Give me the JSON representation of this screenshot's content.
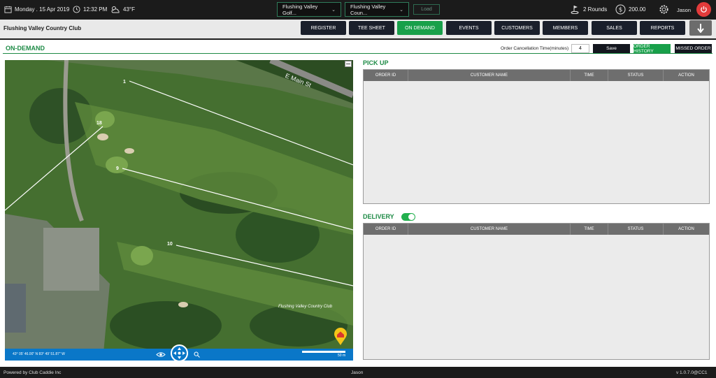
{
  "topbar": {
    "date": "Monday . 15 Apr 2019",
    "time": "12:32 PM",
    "weather": "43°F",
    "course_select": "Flushing Valley Golf...",
    "club_select": "Flushing Valley Coun...",
    "load_label": "Load",
    "rounds": "2 Rounds",
    "balance": "200.00",
    "user": "Jason"
  },
  "subbar": {
    "club_name": "Flushing Valley Country Club",
    "nav": [
      "REGISTER",
      "TEE SHEET",
      "ON DEMAND",
      "EVENTS",
      "CUSTOMERS",
      "MEMBERS",
      "SALES",
      "REPORTS"
    ],
    "active_nav": "ON DEMAND"
  },
  "ondemand": {
    "title": "ON-DEMAND",
    "cancel_label": "Order Cancellation Time(minutes)",
    "cancel_value": "4",
    "save_label": "Save",
    "order_history_label": "ORDER HISTORY",
    "missed_order_label": "MISSED ORDER"
  },
  "map": {
    "street_label": "E Main St",
    "club_label": "Flushing Valley Country Club",
    "holes": [
      "1",
      "18",
      "9",
      "10"
    ],
    "coordinates": "43° 05' 46.00\" N 83° 49' 51.87\" W",
    "scale": "50 m"
  },
  "pickup": {
    "title": "PICK UP",
    "columns": [
      "ORDER ID",
      "CUSTOMER NAME",
      "TIME",
      "STATUS",
      "ACTION"
    ]
  },
  "delivery": {
    "title": "DELIVERY",
    "toggle_on": true,
    "columns": [
      "ORDER ID",
      "CUSTOMER NAME",
      "TIME",
      "STATUS",
      "ACTION"
    ]
  },
  "footer": {
    "powered": "Powered by Club Caddie Inc",
    "user": "Jason",
    "version": "v 1.0.7.0@CC1"
  },
  "colors": {
    "accent_green": "#18a04a",
    "dark": "#1b1b1b",
    "map_bar": "#0a77c8",
    "power_red": "#e23b3b"
  }
}
